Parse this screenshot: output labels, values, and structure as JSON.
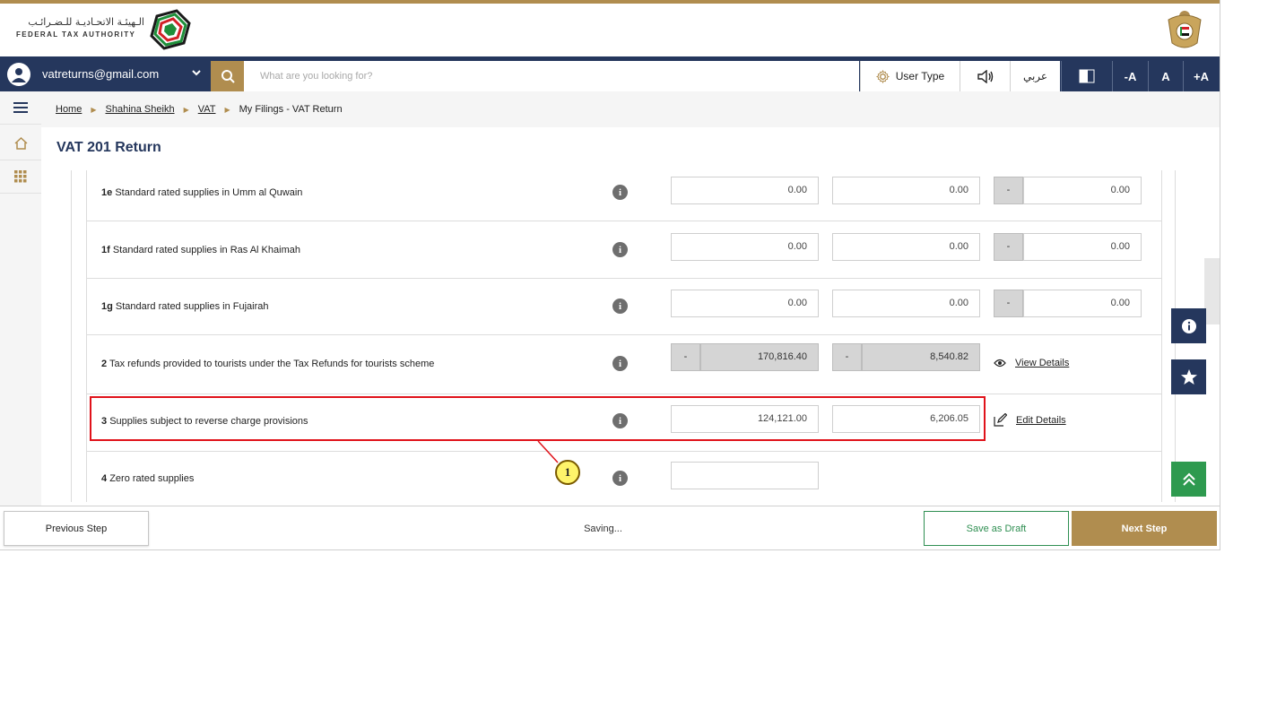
{
  "brand": {
    "name_ar": "الـهيئـة الاتحـاديـة للـضـرائـب",
    "name_en": "FEDERAL TAX AUTHORITY",
    "accent_color": "#b08d4f",
    "navy_color": "#25375d"
  },
  "toolbar": {
    "user_email": "vatreturns@gmail.com",
    "search_placeholder": "What are you looking for?",
    "user_type_label": "User Type",
    "arabic_label": "عربي",
    "font_decrease_label": "-A",
    "font_reset_label": "A",
    "font_increase_label": "+A"
  },
  "breadcrumb": {
    "items": [
      "Home",
      "Shahina Sheikh",
      "VAT"
    ],
    "current": "My Filings - VAT Return"
  },
  "page": {
    "title": "VAT 201 Return"
  },
  "rows": [
    {
      "code": "1e",
      "label": "Standard rated supplies in Umm al Quwain",
      "amount": "0.00",
      "vat": "0.00",
      "adjust_dash": "-",
      "adjust": "0.00"
    },
    {
      "code": "1f",
      "label": "Standard rated supplies in Ras Al Khaimah",
      "amount": "0.00",
      "vat": "0.00",
      "adjust_dash": "-",
      "adjust": "0.00"
    },
    {
      "code": "1g",
      "label": "Standard rated supplies in Fujairah",
      "amount": "0.00",
      "vat": "0.00",
      "adjust_dash": "-",
      "adjust": "0.00"
    },
    {
      "code": "2",
      "label": "Tax refunds provided to tourists under the Tax Refunds for tourists scheme",
      "amount_dash": "-",
      "amount": "170,816.40",
      "vat_dash": "-",
      "vat": "8,540.82",
      "link": "View Details"
    },
    {
      "code": "3",
      "label": "Supplies subject to reverse charge provisions",
      "amount": "124,121.00",
      "vat": "6,206.05",
      "link": "Edit Details"
    },
    {
      "code": "4",
      "label": "Zero rated supplies",
      "amount": ""
    }
  ],
  "annotation": {
    "callout_number": "1"
  },
  "footer": {
    "previous_label": "Previous Step",
    "status": "Saving...",
    "draft_label": "Save as Draft",
    "next_label": "Next Step"
  }
}
